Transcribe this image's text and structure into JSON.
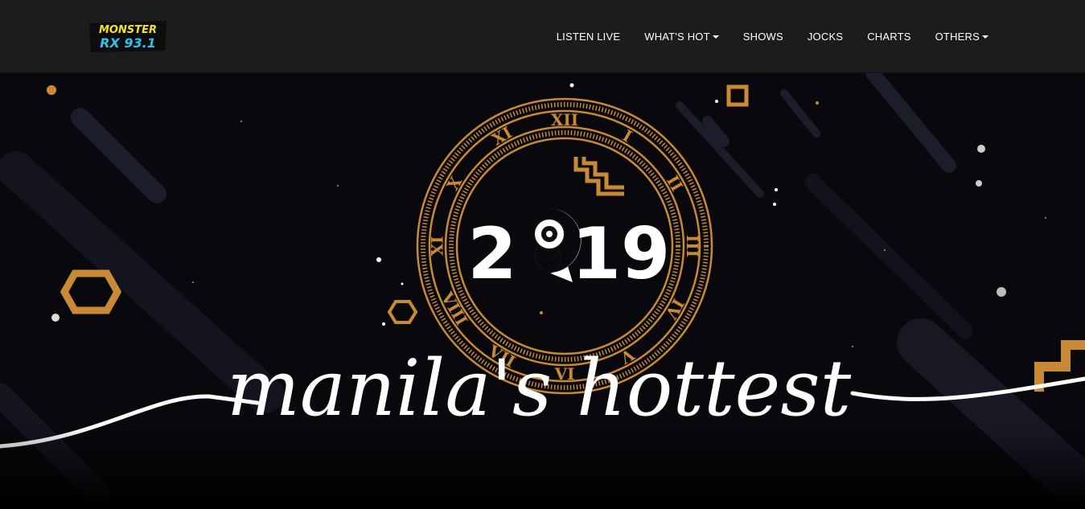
{
  "brand": {
    "logo_line1": "MONSTER",
    "logo_line2": "RX 93.1"
  },
  "nav": {
    "items": [
      {
        "label": "LISTEN LIVE",
        "dropdown": false
      },
      {
        "label": "WHAT'S HOT",
        "dropdown": true
      },
      {
        "label": "SHOWS",
        "dropdown": false
      },
      {
        "label": "JOCKS",
        "dropdown": false
      },
      {
        "label": "CHARTS",
        "dropdown": false
      },
      {
        "label": "OTHERS",
        "dropdown": true
      }
    ]
  },
  "hero": {
    "year_left": "2",
    "year_right": "19",
    "tagline": "manila's hottest",
    "numerals": [
      "XII",
      "I",
      "II",
      "III",
      "IV",
      "V",
      "VI",
      "VII",
      "VIII",
      "IX",
      "X",
      "XI"
    ]
  },
  "colors": {
    "nav_bg": "#1c1c1c",
    "gold": "#c98a35",
    "hero_bg": "#08080d",
    "logo_yellow": "#f3e22a",
    "logo_cyan": "#2cc4e8"
  }
}
